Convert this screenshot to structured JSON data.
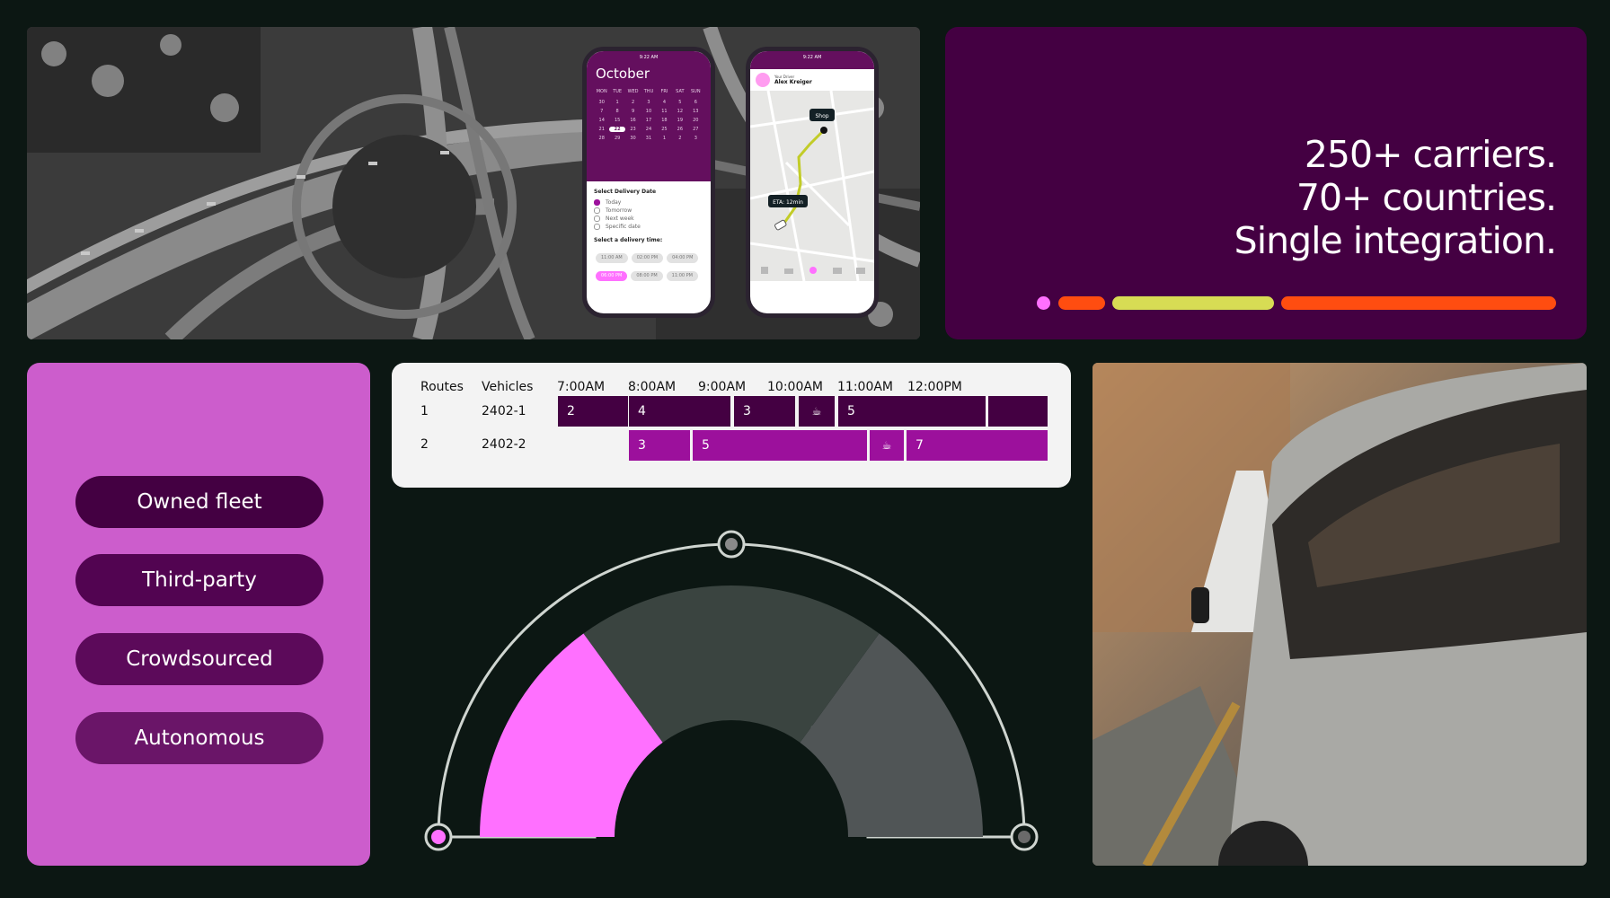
{
  "phone_calendar": {
    "month": "October",
    "time": "9:22 AM",
    "weekdays": [
      "MON",
      "TUE",
      "WED",
      "THU",
      "FRI",
      "SAT",
      "SUN"
    ],
    "days": [
      "30",
      "1",
      "2",
      "3",
      "4",
      "5",
      "6",
      "7",
      "8",
      "9",
      "10",
      "11",
      "12",
      "13",
      "14",
      "15",
      "16",
      "17",
      "18",
      "19",
      "20",
      "21",
      "22",
      "23",
      "24",
      "25",
      "26",
      "27",
      "28",
      "29",
      "30",
      "31",
      "1",
      "2",
      "3"
    ],
    "selected_day": "22",
    "sheet_title": "Select Delivery Date",
    "options": [
      "Today",
      "Tomorrow",
      "Next week",
      "Specific date"
    ],
    "time_title": "Select a delivery time:",
    "slots": [
      "11:00 AM",
      "02:00 PM",
      "04:00 PM",
      "06:00 PM",
      "08:00 PM",
      "11:00 PM"
    ],
    "selected_slot": "06:00 PM"
  },
  "phone_map": {
    "time": "9:22 AM",
    "driver_label": "Your Driver",
    "driver_name": "Alex Kreiger",
    "shop_label": "Shop",
    "eta_label": "ETA: 12min"
  },
  "headline": {
    "line1": "250+ carriers.",
    "line2": "70+ countries.",
    "line3": "Single integration.",
    "colors": [
      "#ff70ff",
      "#ff4d10",
      "#d7dc54",
      "#ff4d10"
    ]
  },
  "fleet": {
    "items": [
      "Owned fleet",
      "Third-party",
      "Crowdsourced",
      "Autonomous"
    ]
  },
  "schedule": {
    "headers": {
      "routes": "Routes",
      "vehicles": "Vehicles"
    },
    "times": [
      "7:00AM",
      "8:00AM",
      "9:00AM",
      "10:00AM",
      "11:00AM",
      "12:00PM"
    ],
    "rows": [
      {
        "route": "1",
        "vehicle": "2402-1",
        "blocks": [
          "2",
          "4",
          "3",
          "5"
        ]
      },
      {
        "route": "2",
        "vehicle": "2402-2",
        "blocks": [
          "3",
          "5",
          "7"
        ]
      }
    ],
    "colors": {
      "row1": "#440042",
      "row2": "#9c109c"
    }
  },
  "gauge": {
    "level": 0.3,
    "colors": {
      "active": "#ff70ff",
      "inactive": "#3a4440",
      "outer": "#505556",
      "ring": "#cfd5d0"
    }
  }
}
